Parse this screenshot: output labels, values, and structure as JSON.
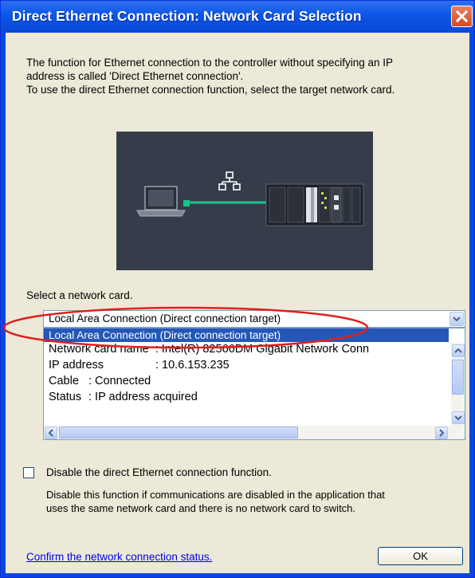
{
  "dialog": {
    "title": "Direct Ethernet Connection: Network Card Selection",
    "intro_lines": [
      "The function for Ethernet connection to the controller without specifying an IP",
      "address is called 'Direct Ethernet connection'.",
      "To use the direct Ethernet connection function, select the target network card."
    ],
    "select_label": "Select a network card.",
    "combo_value": "Local Area Connection (Direct connection target)",
    "list": {
      "selected": "Local Area Connection (Direct connection target)",
      "rows": [
        {
          "label": "Network card name",
          "value": ": Intel(R) 82566DM Gigabit Network Conn"
        },
        {
          "label": "IP address",
          "value": ": 10.6.153.235"
        },
        {
          "label": "Cable",
          "value": ": Connected"
        },
        {
          "label": "Status",
          "value": ": IP address acquired"
        }
      ]
    },
    "checkbox_label": "Disable the direct Ethernet connection function.",
    "checkbox_checked": false,
    "note_lines": [
      "Disable this function if communications are disabled in the application that",
      "uses the same network card and there is no network card to switch."
    ],
    "link_text": "Confirm the network connection status.",
    "ok_label": "OK"
  },
  "icons": [
    "close-icon",
    "laptop-icon",
    "network-icon",
    "controller-icon",
    "chevron-down-icon",
    "scroll-up-icon",
    "scroll-down-icon",
    "scroll-left-icon",
    "scroll-right-icon"
  ],
  "colors": {
    "titlebar": "#0a48d8",
    "close": "#d24a22",
    "selection": "#2457b8",
    "highlight_ellipse": "#e02020",
    "cable": "#19c48a",
    "dialog_bg": "#ece9d8"
  }
}
